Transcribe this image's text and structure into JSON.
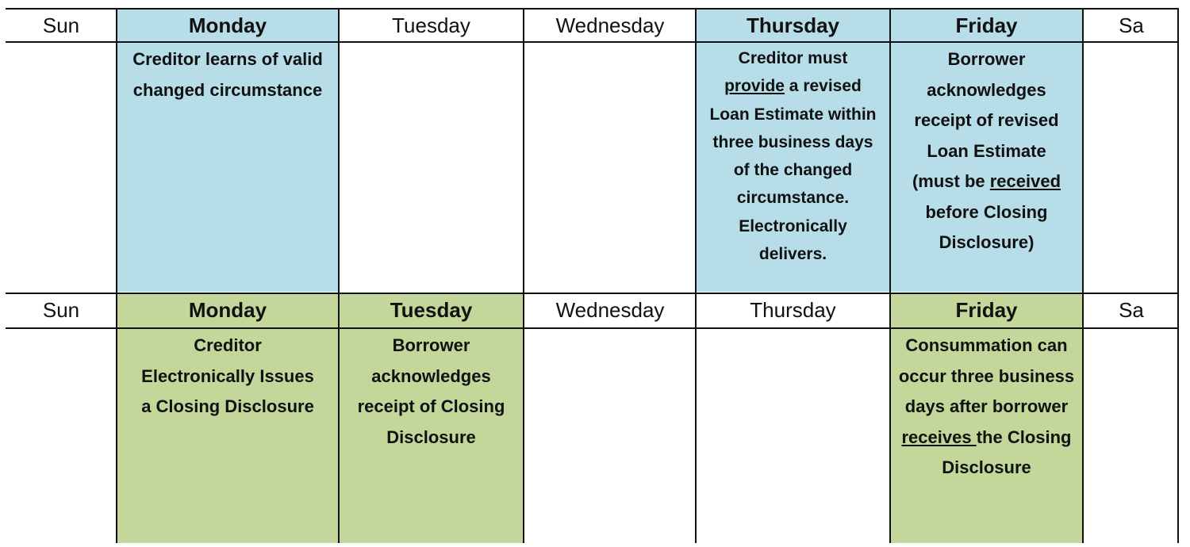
{
  "colors": {
    "highlight_row1": "#b7dde8",
    "highlight_row2": "#c4d79b"
  },
  "week1": {
    "headers": [
      "Sun",
      "Monday",
      "Tuesday",
      "Wednesday",
      "Thursday",
      "Friday",
      "Sa"
    ],
    "monday": "Creditor learns of valid changed circumstance",
    "thursday": {
      "l1": "Creditor must",
      "l2_u": "provide",
      "l2_rest": " a revised",
      "rest": "Loan Estimate within three business days of the changed circumstance. Electronically delivers."
    },
    "friday": {
      "pre": "Borrower acknowledges receipt of revised Loan Estimate (must be ",
      "u": "received",
      "post": " before Closing Disclosure)"
    }
  },
  "week2": {
    "headers": [
      "Sun",
      "Monday",
      "Tuesday",
      "Wednesday",
      "Thursday",
      "Friday",
      "Sa"
    ],
    "monday": "Creditor Electronically Issues a Closing Disclosure",
    "tuesday": "Borrower acknowledges receipt of Closing Disclosure",
    "friday": {
      "pre": "Consummation can occur three business days after borrower ",
      "u": "receives ",
      "post": "the Closing Disclosure"
    }
  }
}
